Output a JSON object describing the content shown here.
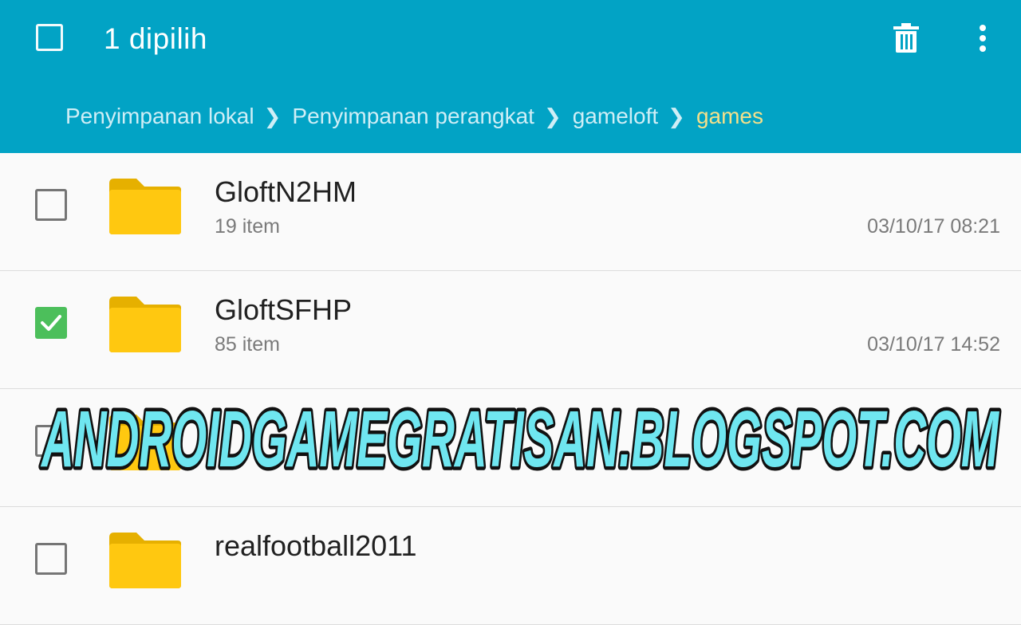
{
  "header": {
    "title": "1 dipilih",
    "select_all_icon": "checkbox-empty-icon",
    "delete_icon": "trash-icon",
    "more_icon": "more-vert-icon",
    "bg_color": "#02a3c5"
  },
  "breadcrumb": {
    "items": [
      "Penyimpanan lokal",
      "Penyimpanan perangkat",
      "gameloft",
      "games"
    ],
    "current_color": "#f4e08a"
  },
  "files": [
    {
      "name": "GloftN2HM",
      "count": "19 item",
      "date": "03/10/17 08:21",
      "checked": false
    },
    {
      "name": "GloftSFHP",
      "count": "85 item",
      "date": "03/10/17 14:52",
      "checked": true
    },
    {
      "name": "",
      "count": "",
      "date": "",
      "checked": false
    },
    {
      "name": "realfootball2011",
      "count": "",
      "date": "",
      "checked": false
    }
  ],
  "watermark": {
    "text": "ANDROIDGAMEGRATISAN.BLOGSPOT.COM",
    "fill_color": "#6fe6f0",
    "stroke_color": "#111111"
  },
  "colors": {
    "folder": "#ffc810",
    "checked": "#4cbf5b"
  }
}
